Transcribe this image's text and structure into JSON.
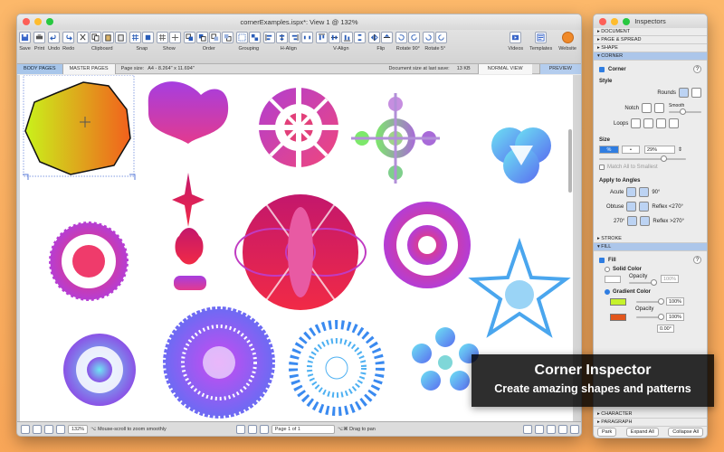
{
  "window": {
    "title": "cornerExamples.ispx*: View 1 @ 132%"
  },
  "toolbar": {
    "labels": [
      "Save",
      "Print",
      "Undo",
      "Redo",
      "Clipboard",
      "Snap",
      "Show",
      "Order",
      "Grouping",
      "H-Align",
      "V-Align",
      "Flip",
      "Rotate 90°",
      "Rotate 5°",
      "Videos",
      "Templates",
      "Website"
    ]
  },
  "infobar": {
    "tab_body": "BODY PAGES",
    "tab_master": "MASTER PAGES",
    "page_size_label": "Page size:",
    "page_size_value": "A4 - 8.264\" x 11.694\"",
    "doc_size": "Document size at last save:",
    "doc_size_value": "13 KB",
    "normal_view": "NORMAL VIEW",
    "preview": "PREVIEW"
  },
  "statusbar": {
    "zoom": "132%",
    "zoom_hint": "⌥ Mouse-scroll to zoom smoothly",
    "page": "Page 1 of 1",
    "pan_hint": "⌥⌘ Drag to pan"
  },
  "inspector": {
    "title": "Inspectors",
    "sections_top": [
      "DOCUMENT",
      "PAGE & SPREAD",
      "SHAPE"
    ],
    "corner_section": "CORNER",
    "corner_label": "Corner",
    "style_label": "Style",
    "rounds": "Rounds",
    "notch": "Notch",
    "smooth": "Smooth",
    "loops": "Loops",
    "size_label": "Size",
    "size_unit": "%",
    "size_value": "29%",
    "match_all": "Match All to Smallest",
    "apply_angles": "Apply to Angles",
    "acute": "Acute",
    "deg90": "90°",
    "obtuse": "Obtuse",
    "reflex_lt": "Reflex <270°",
    "deg270": "270°",
    "reflex_gt": "Reflex >270°",
    "stroke_section": "STROKE",
    "fill_section": "FILL",
    "fill_label": "Fill",
    "solid_color": "Solid Color",
    "opacity": "Opacity",
    "opacity_solid": "100%",
    "gradient_color": "Gradient Color",
    "opacity_grad1": "100%",
    "opacity_grad2": "100%",
    "angle_value": "0.00°",
    "sections_bottom": [
      "CHARACTER",
      "PARAGRAPH"
    ],
    "btn_park": "Park",
    "btn_expand": "Expand All",
    "btn_collapse": "Collapse All",
    "corner_checked": true,
    "fill_checked": true,
    "accent": "#2f7de1",
    "section_highlight": "#acc6ea"
  },
  "caption": {
    "title": "Corner Inspector",
    "subtitle": "Create amazing shapes and patterns"
  }
}
